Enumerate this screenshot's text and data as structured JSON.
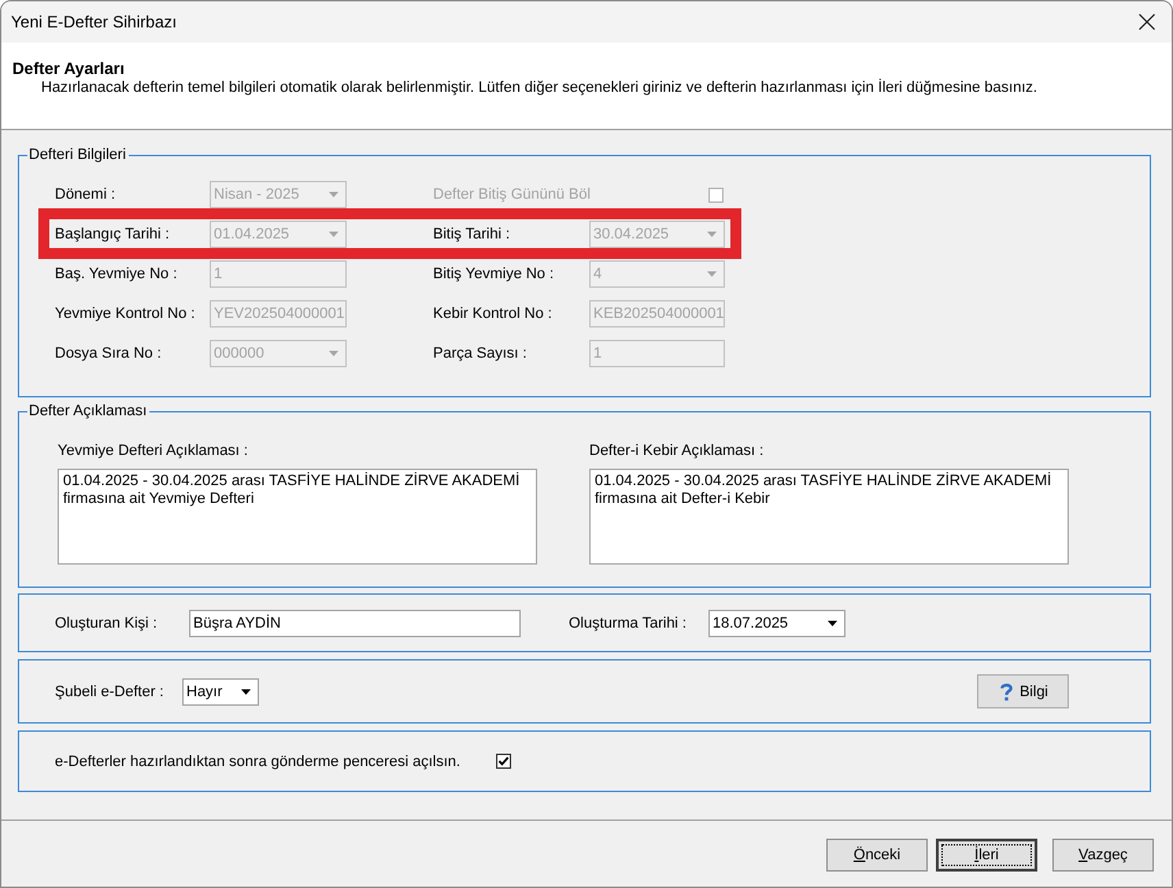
{
  "window": {
    "title": "Yeni E-Defter Sihirbazı"
  },
  "header": {
    "title": "Defter Ayarları",
    "description": "Hazırlanacak defterin temel bilgileri otomatik olarak belirlenmiştir. Lütfen diğer seçenekleri giriniz ve defterin hazırlanması için İleri düğmesine basınız."
  },
  "defter_bilgileri": {
    "legend": "Defteri Bilgileri",
    "rows": [
      {
        "highlighted": false,
        "fields": [
          {
            "kind": "combo",
            "label": "Dönemi :",
            "value": "Nisan - 2025",
            "disabled": true
          },
          {
            "kind": "checkbox",
            "label": "Defter Bitiş Gününü Böl",
            "checked": false,
            "disabled": true
          }
        ]
      },
      {
        "highlighted": true,
        "fields": [
          {
            "kind": "combo",
            "label": "Başlangıç Tarihi :",
            "value": "01.04.2025",
            "disabled": true
          },
          {
            "kind": "combo",
            "label": "Bitiş Tarihi :",
            "value": "30.04.2025",
            "disabled": true
          }
        ]
      },
      {
        "highlighted": false,
        "fields": [
          {
            "kind": "text",
            "label": "Baş. Yevmiye No :",
            "value": "1",
            "disabled": true
          },
          {
            "kind": "combo",
            "label": "Bitiş Yevmiye No :",
            "value": "4",
            "disabled": true
          }
        ]
      },
      {
        "highlighted": false,
        "fields": [
          {
            "kind": "text",
            "label": "Yevmiye Kontrol No :",
            "value": "YEV202504000001",
            "disabled": true
          },
          {
            "kind": "text",
            "label": "Kebir Kontrol No :",
            "value": "KEB202504000001",
            "disabled": true
          }
        ]
      },
      {
        "highlighted": false,
        "fields": [
          {
            "kind": "combo",
            "label": "Dosya Sıra No :",
            "value": "000000",
            "disabled": true
          },
          {
            "kind": "text",
            "label": "Parça Sayısı :",
            "value": "1",
            "disabled": true
          }
        ]
      }
    ]
  },
  "defter_aciklamasi": {
    "legend": "Defter Açıklaması",
    "fields": [
      {
        "label": "Yevmiye Defteri Açıklaması :",
        "value": "01.04.2025 - 30.04.2025 arası TASFİYE HALİNDE ZİRVE AKADEMİ firmasına ait Yevmiye Defteri"
      },
      {
        "label": "Defter-i Kebir Açıklaması :",
        "value": "01.04.2025 - 30.04.2025 arası TASFİYE HALİNDE ZİRVE AKADEMİ firmasına ait Defter-i Kebir"
      }
    ]
  },
  "olusturma": {
    "fields": [
      {
        "kind": "text",
        "label": "Oluşturan Kişi :",
        "value": "Büşra AYDİN"
      },
      {
        "kind": "combo",
        "label": "Oluşturma Tarihi :",
        "value": "18.07.2025"
      }
    ]
  },
  "subeli": {
    "label": "Şubeli e-Defter :",
    "value": "Hayır",
    "info_button": "Bilgi"
  },
  "gonderme": {
    "label": "e-Defterler hazırlandıktan sonra gönderme penceresi açılsın.",
    "checked": true
  },
  "buttons": [
    {
      "label": "Önceki",
      "default": false,
      "mnemonic": true
    },
    {
      "label": "İleri",
      "default": true,
      "mnemonic": true
    },
    {
      "label": "Vazgeç",
      "default": false,
      "mnemonic": true
    }
  ]
}
